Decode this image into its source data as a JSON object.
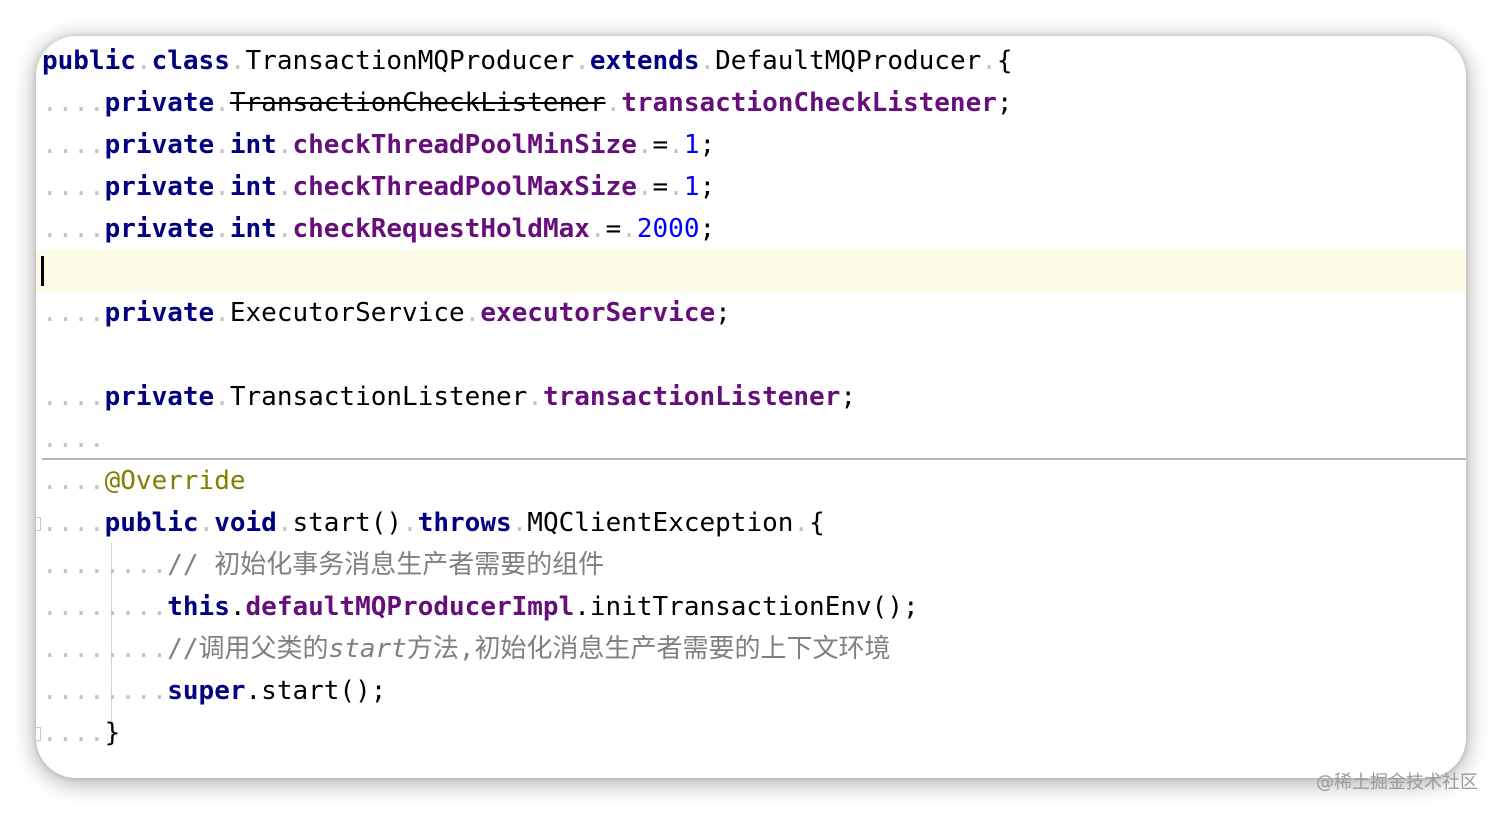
{
  "editor": {
    "class_decl": {
      "kw_public": "public",
      "kw_class": "class",
      "class_name": "TransactionMQProducer",
      "kw_extends": "extends",
      "super_name": "DefaultMQProducer",
      "brace": "{"
    },
    "fields": [
      {
        "kw_private": "private",
        "type": "TransactionCheckListener",
        "name": "transactionCheckListener",
        "end": ";"
      },
      {
        "kw_private": "private",
        "type": "int",
        "name": "checkThreadPoolMinSize",
        "assign": "=",
        "value": "1",
        "end": ";"
      },
      {
        "kw_private": "private",
        "type": "int",
        "name": "checkThreadPoolMaxSize",
        "assign": "=",
        "value": "1",
        "end": ";"
      },
      {
        "kw_private": "private",
        "type": "int",
        "name": "checkRequestHoldMax",
        "assign": "=",
        "value": "2000",
        "end": ";"
      },
      {
        "kw_private": "private",
        "type": "ExecutorService",
        "name": "executorService",
        "end": ";"
      },
      {
        "kw_private": "private",
        "type": "TransactionListener",
        "name": "transactionListener",
        "end": ";"
      }
    ],
    "method": {
      "annotation": "@Override",
      "kw_public": "public",
      "kw_void": "void",
      "signature": "start()",
      "kw_throws": "throws",
      "exception": "MQClientException",
      "brace": "{",
      "comment1": "// 初始化事务消息生产者需要的组件",
      "kw_this": "this",
      "dot1": ".",
      "field_impl": "defaultMQProducerImpl",
      "call1": ".initTransactionEnv();",
      "comment2_prefix": "//调用父类的",
      "comment2_italic": "start",
      "comment2_suffix": "方法,初始化消息生产者需要的上下文环境",
      "kw_super": "super",
      "call2": ".start();",
      "close_brace": "}"
    }
  },
  "watermark": "@稀土掘金技术社区",
  "colors": {
    "keyword": "#000080",
    "field": "#660e7a",
    "number": "#0000ff",
    "annotation": "#808000",
    "comment": "#808080",
    "caret_line": "#fdfae5"
  }
}
